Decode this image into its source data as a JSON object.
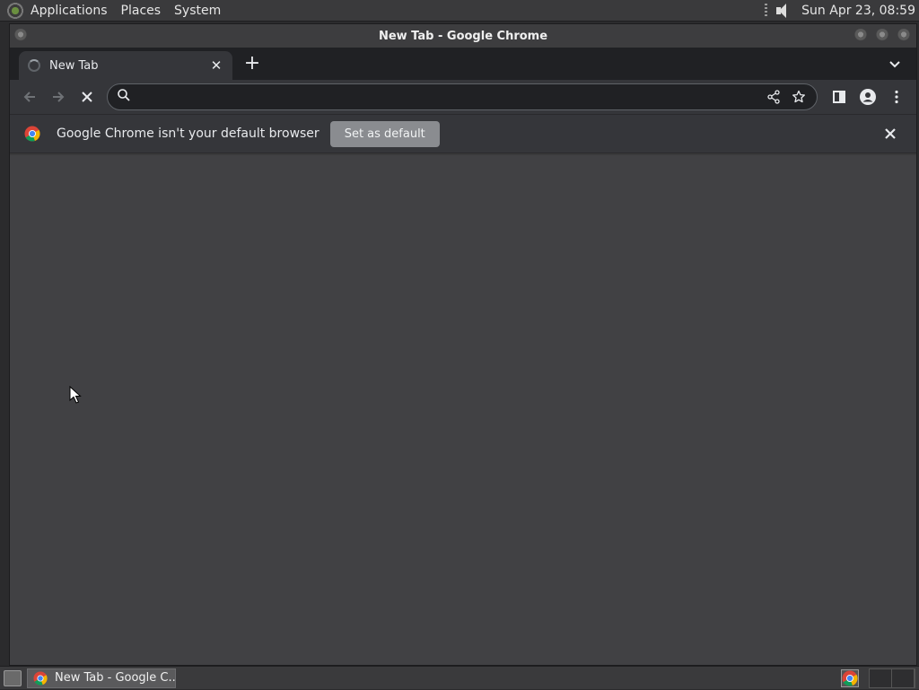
{
  "top_panel": {
    "menus": [
      "Applications",
      "Places",
      "System"
    ],
    "clock": "Sun Apr 23, 08:59"
  },
  "window": {
    "title": "New Tab - Google Chrome"
  },
  "tabs": [
    {
      "title": "New Tab",
      "loading": true
    }
  ],
  "omnibox": {
    "value": "",
    "placeholder": ""
  },
  "infobar": {
    "message": "Google Chrome isn't your default browser",
    "button_label": "Set as default"
  },
  "taskbar": {
    "items": [
      {
        "label": "New Tab - Google C..."
      }
    ]
  },
  "colors": {
    "content_bg": "#414144",
    "toolbar_bg": "#35363a",
    "tabstrip_bg": "#202124",
    "accent_chrome_red": "#db4437",
    "accent_chrome_yellow": "#f4b400",
    "accent_chrome_green": "#0f9d58",
    "accent_chrome_blue": "#4285f4"
  }
}
